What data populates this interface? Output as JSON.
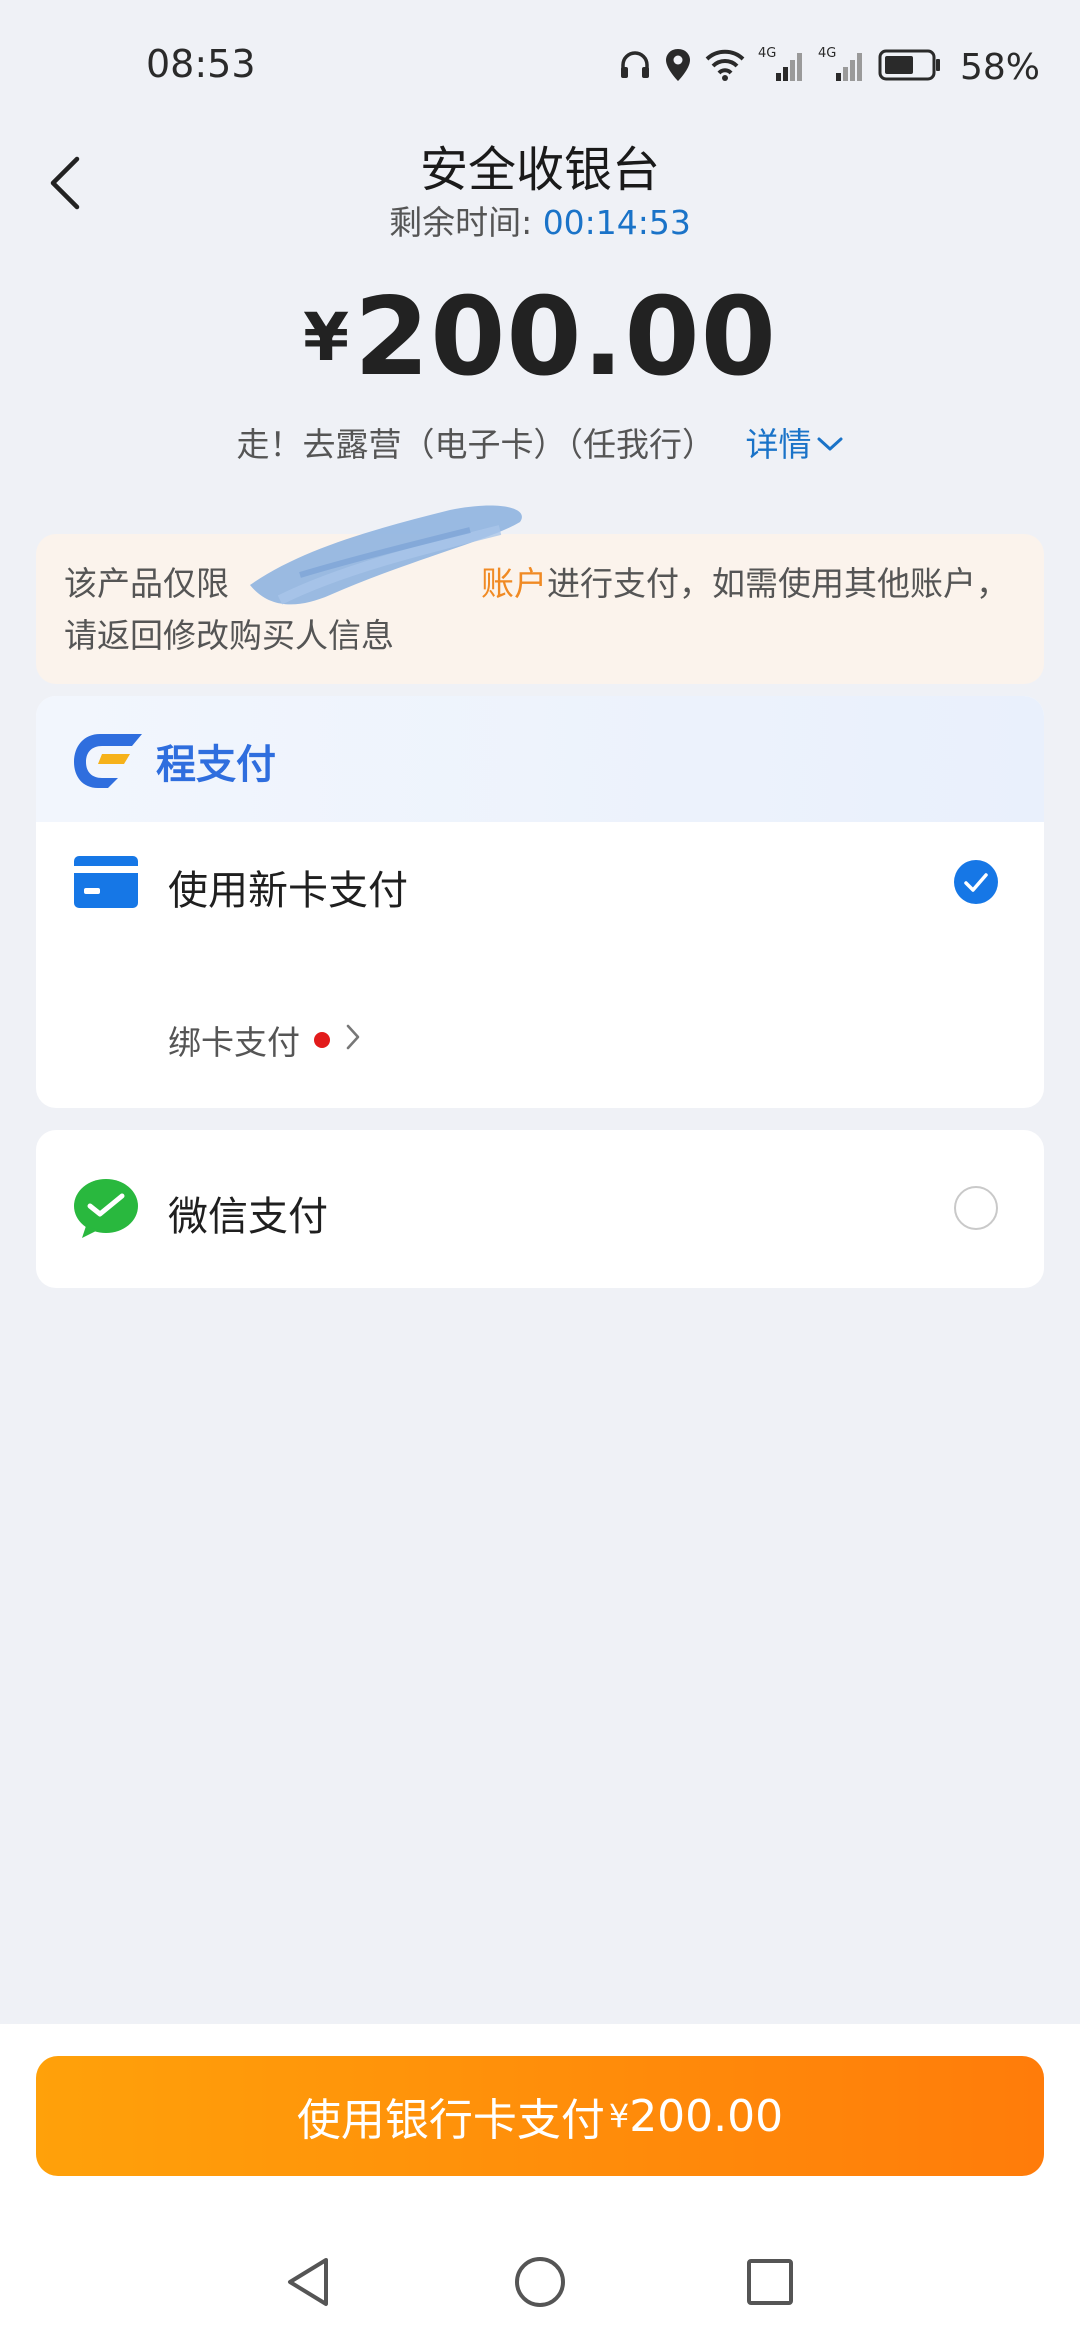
{
  "status_bar": {
    "time": "08:53",
    "battery_text": "58%",
    "icons": [
      "headphones-icon",
      "location-icon",
      "wifi-icon",
      "signal-4g-icon",
      "signal-4g-icon",
      "battery-icon"
    ],
    "network_label": "4G"
  },
  "header": {
    "title": "安全收银台",
    "timer_label": "剩余时间: ",
    "timer_value": "00:14:53"
  },
  "order": {
    "currency": "¥",
    "amount": "200.00",
    "product": "走！去露营（电子卡）（任我行）",
    "detail_label": "详情"
  },
  "notice": {
    "prefix": "该产品仅限",
    "highlight": "账户",
    "suffix": "进行支付，如需使用其他账户，请返回修改购买人信息"
  },
  "payment_card": {
    "brand_name": "程支付",
    "method_label": "使用新卡支付",
    "method_selected": true,
    "bind_label": "绑卡支付"
  },
  "wechat_card": {
    "label": "微信支付",
    "selected": false
  },
  "action": {
    "pay_label": "使用银行卡支付",
    "currency": "¥",
    "amount": "200.00"
  },
  "colors": {
    "accent_blue": "#1677e6",
    "link_blue": "#1a73c8",
    "orange_start": "#ffa10a",
    "orange_end": "#ff7c0a",
    "wechat_green": "#29b83e",
    "background": "#eff1f6"
  }
}
